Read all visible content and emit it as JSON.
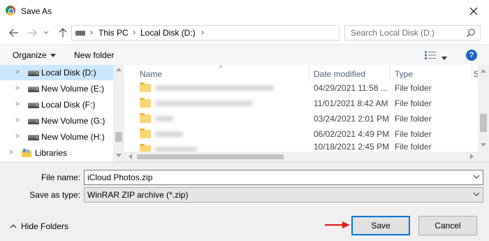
{
  "window": {
    "title": "Save As"
  },
  "address": {
    "crumbs": [
      "This PC",
      "Local Disk (D:)"
    ]
  },
  "search": {
    "placeholder": "Search Local Disk (D:)"
  },
  "toolbar": {
    "organize_label": "Organize",
    "new_folder_label": "New folder"
  },
  "nav": {
    "items": [
      {
        "label": "Local Disk (D:)",
        "icon": "drive-icon",
        "selected": true
      },
      {
        "label": "New Volume (E:)",
        "icon": "drive-icon"
      },
      {
        "label": "Local Disk (F:)",
        "icon": "drive-icon"
      },
      {
        "label": "New Volume (G:)",
        "icon": "drive-icon"
      },
      {
        "label": "New Volume (H:)",
        "icon": "drive-icon"
      },
      {
        "label": "Libraries",
        "icon": "libraries-icon"
      }
    ]
  },
  "files": {
    "columns": {
      "name": "Name",
      "date": "Date modified",
      "type": "Type",
      "size": "S"
    },
    "rows": [
      {
        "date": "04/29/2021 11:58 ...",
        "type": "File folder"
      },
      {
        "date": "11/01/2021 8:42 AM",
        "type": "File folder"
      },
      {
        "date": "03/24/2021 2:01 PM",
        "type": "File folder"
      },
      {
        "date": "06/02/2021 4:49 PM",
        "type": "File folder"
      },
      {
        "date": "10/18/2021 2:45 PM",
        "type": "File folder"
      }
    ]
  },
  "form": {
    "file_name_label": "File name:",
    "file_name_value": "iCloud Photos.zip",
    "save_type_label": "Save as type:",
    "save_type_value": "WinRAR ZIP archive (*.zip)"
  },
  "footer": {
    "hide_folders_label": "Hide Folders",
    "save_label": "Save",
    "cancel_label": "Cancel"
  },
  "colors": {
    "accent": "#0078d7",
    "selection": "#cce8ff",
    "arrow": "#e02020",
    "help": "#1a64c8"
  }
}
